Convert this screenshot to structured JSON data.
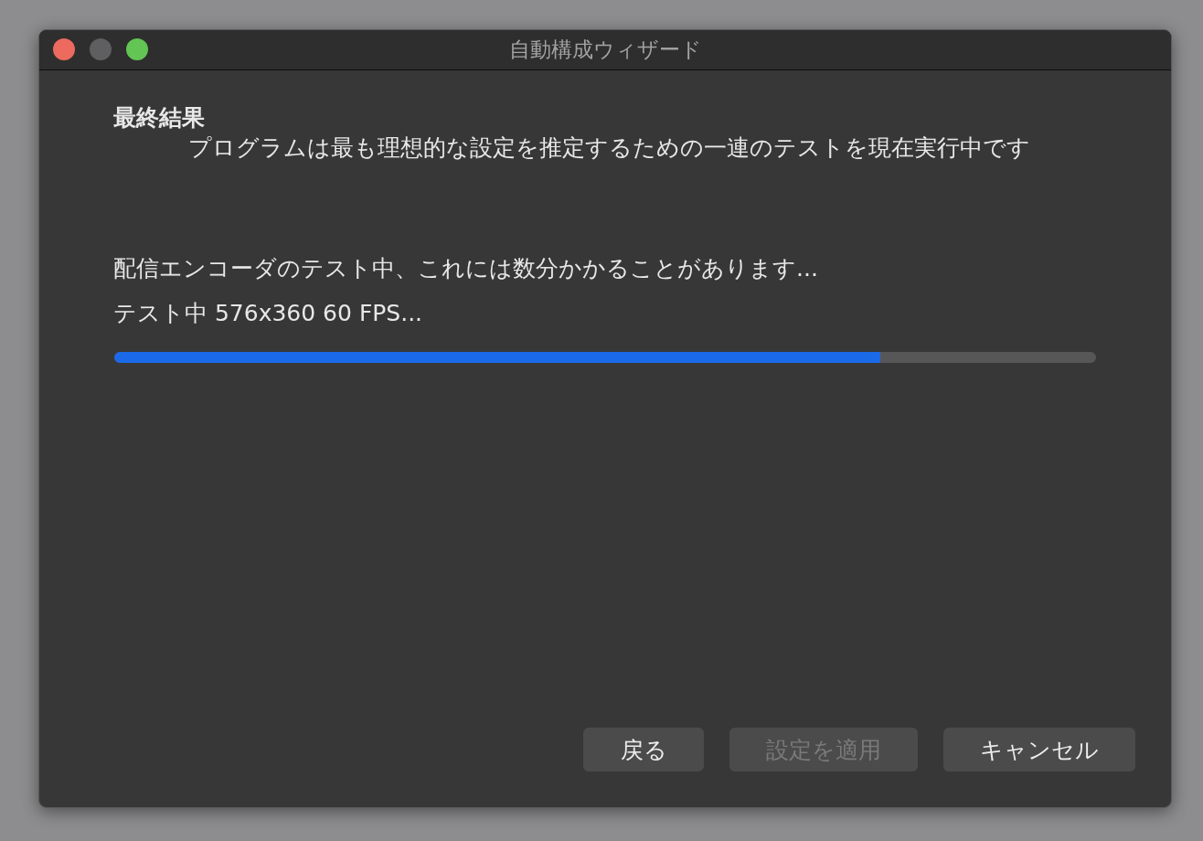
{
  "window": {
    "title": "自動構成ウィザード",
    "controls": [
      {
        "kind": "close",
        "disabled": false
      },
      {
        "kind": "minimize",
        "disabled": true
      },
      {
        "kind": "zoom",
        "disabled": false
      }
    ]
  },
  "page": {
    "title": "最終結果",
    "description": "プログラムは最も理想的な設定を推定するための一連のテストを現在実行中です"
  },
  "status_lines": [
    "配信エンコーダのテスト中、これには数分かかることがあります...",
    "テスト中 576x360 60 FPS..."
  ],
  "progress": {
    "level": 0.78
  },
  "buttons": [
    {
      "label": "戻る",
      "disabled": false
    },
    {
      "label": "設定を適用",
      "disabled": true
    },
    {
      "label": "キャンセル",
      "disabled": false
    }
  ]
}
